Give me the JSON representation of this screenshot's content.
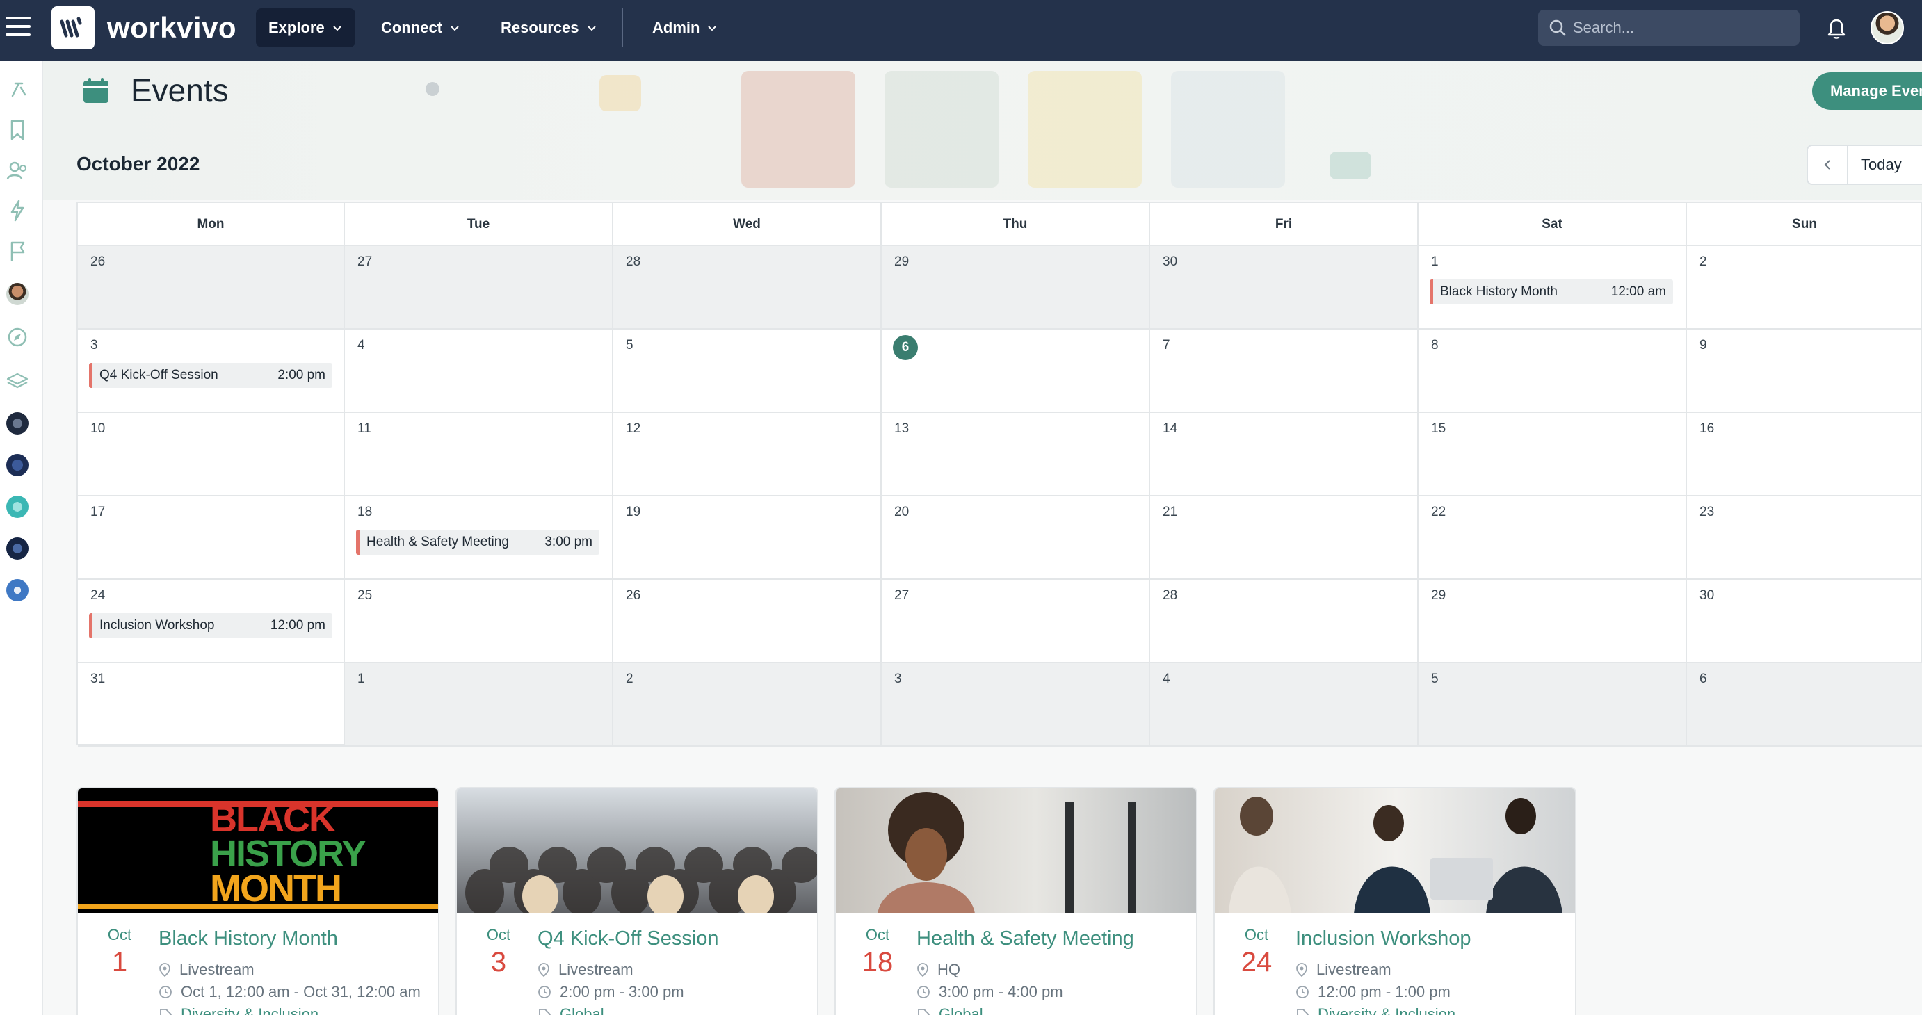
{
  "topbar": {
    "brand": "workvivo",
    "nav": [
      {
        "label": "Explore",
        "active": true
      },
      {
        "label": "Connect",
        "active": false
      },
      {
        "label": "Resources",
        "active": false
      },
      {
        "label": "Admin",
        "active": false
      }
    ],
    "search_placeholder": "Search..."
  },
  "header": {
    "title": "Events",
    "manage_button": "Manage Even",
    "month_label": "October 2022",
    "today_button": "Today"
  },
  "calendar": {
    "weekdays": [
      "Mon",
      "Tue",
      "Wed",
      "Thu",
      "Fri",
      "Sat",
      "Sun"
    ],
    "today": "6",
    "weeks": [
      [
        {
          "day": "26",
          "other": true
        },
        {
          "day": "27",
          "other": true
        },
        {
          "day": "28",
          "other": true
        },
        {
          "day": "29",
          "other": true
        },
        {
          "day": "30",
          "other": true
        },
        {
          "day": "1",
          "event": {
            "title": "Black History Month",
            "time": "12:00 am"
          }
        },
        {
          "day": "2"
        }
      ],
      [
        {
          "day": "3",
          "event": {
            "title": "Q4 Kick-Off Session",
            "time": "2:00 pm"
          }
        },
        {
          "day": "4"
        },
        {
          "day": "5"
        },
        {
          "day": "6",
          "today": true
        },
        {
          "day": "7"
        },
        {
          "day": "8"
        },
        {
          "day": "9"
        }
      ],
      [
        {
          "day": "10"
        },
        {
          "day": "11"
        },
        {
          "day": "12"
        },
        {
          "day": "13"
        },
        {
          "day": "14"
        },
        {
          "day": "15"
        },
        {
          "day": "16"
        }
      ],
      [
        {
          "day": "17"
        },
        {
          "day": "18",
          "event": {
            "title": "Health & Safety Meeting",
            "time": "3:00 pm"
          }
        },
        {
          "day": "19"
        },
        {
          "day": "20"
        },
        {
          "day": "21"
        },
        {
          "day": "22"
        },
        {
          "day": "23"
        }
      ],
      [
        {
          "day": "24",
          "event": {
            "title": "Inclusion Workshop",
            "time": "12:00 pm"
          }
        },
        {
          "day": "25"
        },
        {
          "day": "26"
        },
        {
          "day": "27"
        },
        {
          "day": "28"
        },
        {
          "day": "29"
        },
        {
          "day": "30"
        }
      ],
      [
        {
          "day": "31"
        },
        {
          "day": "1",
          "other": true
        },
        {
          "day": "2",
          "other": true
        },
        {
          "day": "3",
          "other": true
        },
        {
          "day": "4",
          "other": true
        },
        {
          "day": "5",
          "other": true
        },
        {
          "day": "6",
          "other": true
        }
      ]
    ]
  },
  "cards": [
    {
      "month": "Oct",
      "day": "1",
      "title": "Black History Month",
      "location": "Livestream",
      "time": "Oct 1, 12:00 am - Oct 31, 12:00 am",
      "tag": "Diversity & Inclusion",
      "image": "black-history-month-poster",
      "poster_lines": [
        "BLACK",
        "HISTORY",
        "MONTH"
      ]
    },
    {
      "month": "Oct",
      "day": "3",
      "title": "Q4 Kick-Off Session",
      "location": "Livestream",
      "time": "2:00 pm - 3:00 pm",
      "tag": "Global",
      "image": "audience-photo"
    },
    {
      "month": "Oct",
      "day": "18",
      "title": "Health & Safety Meeting",
      "location": "HQ",
      "time": "3:00 pm - 4:00 pm",
      "tag": "Global",
      "image": "woman-office-photo"
    },
    {
      "month": "Oct",
      "day": "24",
      "title": "Inclusion Workshop",
      "location": "Livestream",
      "time": "12:00 pm - 1:00 pm",
      "tag": "Diversity & Inclusion",
      "image": "team-meeting-photo"
    }
  ],
  "icons": {
    "rail": [
      "sparkle-icon",
      "bookmark-icon",
      "people-icon",
      "bolt-icon",
      "flag-icon",
      "avatar-icon",
      "compass-icon",
      "layers-icon",
      "space-icon",
      "space-icon",
      "space-icon",
      "space-icon",
      "space-icon"
    ]
  },
  "colors": {
    "topbar": "#24324b",
    "accent": "#3d8f7e",
    "event_marker": "#e4746a",
    "today_circle": "#3a7d6f",
    "date_day": "#d94a3f"
  }
}
